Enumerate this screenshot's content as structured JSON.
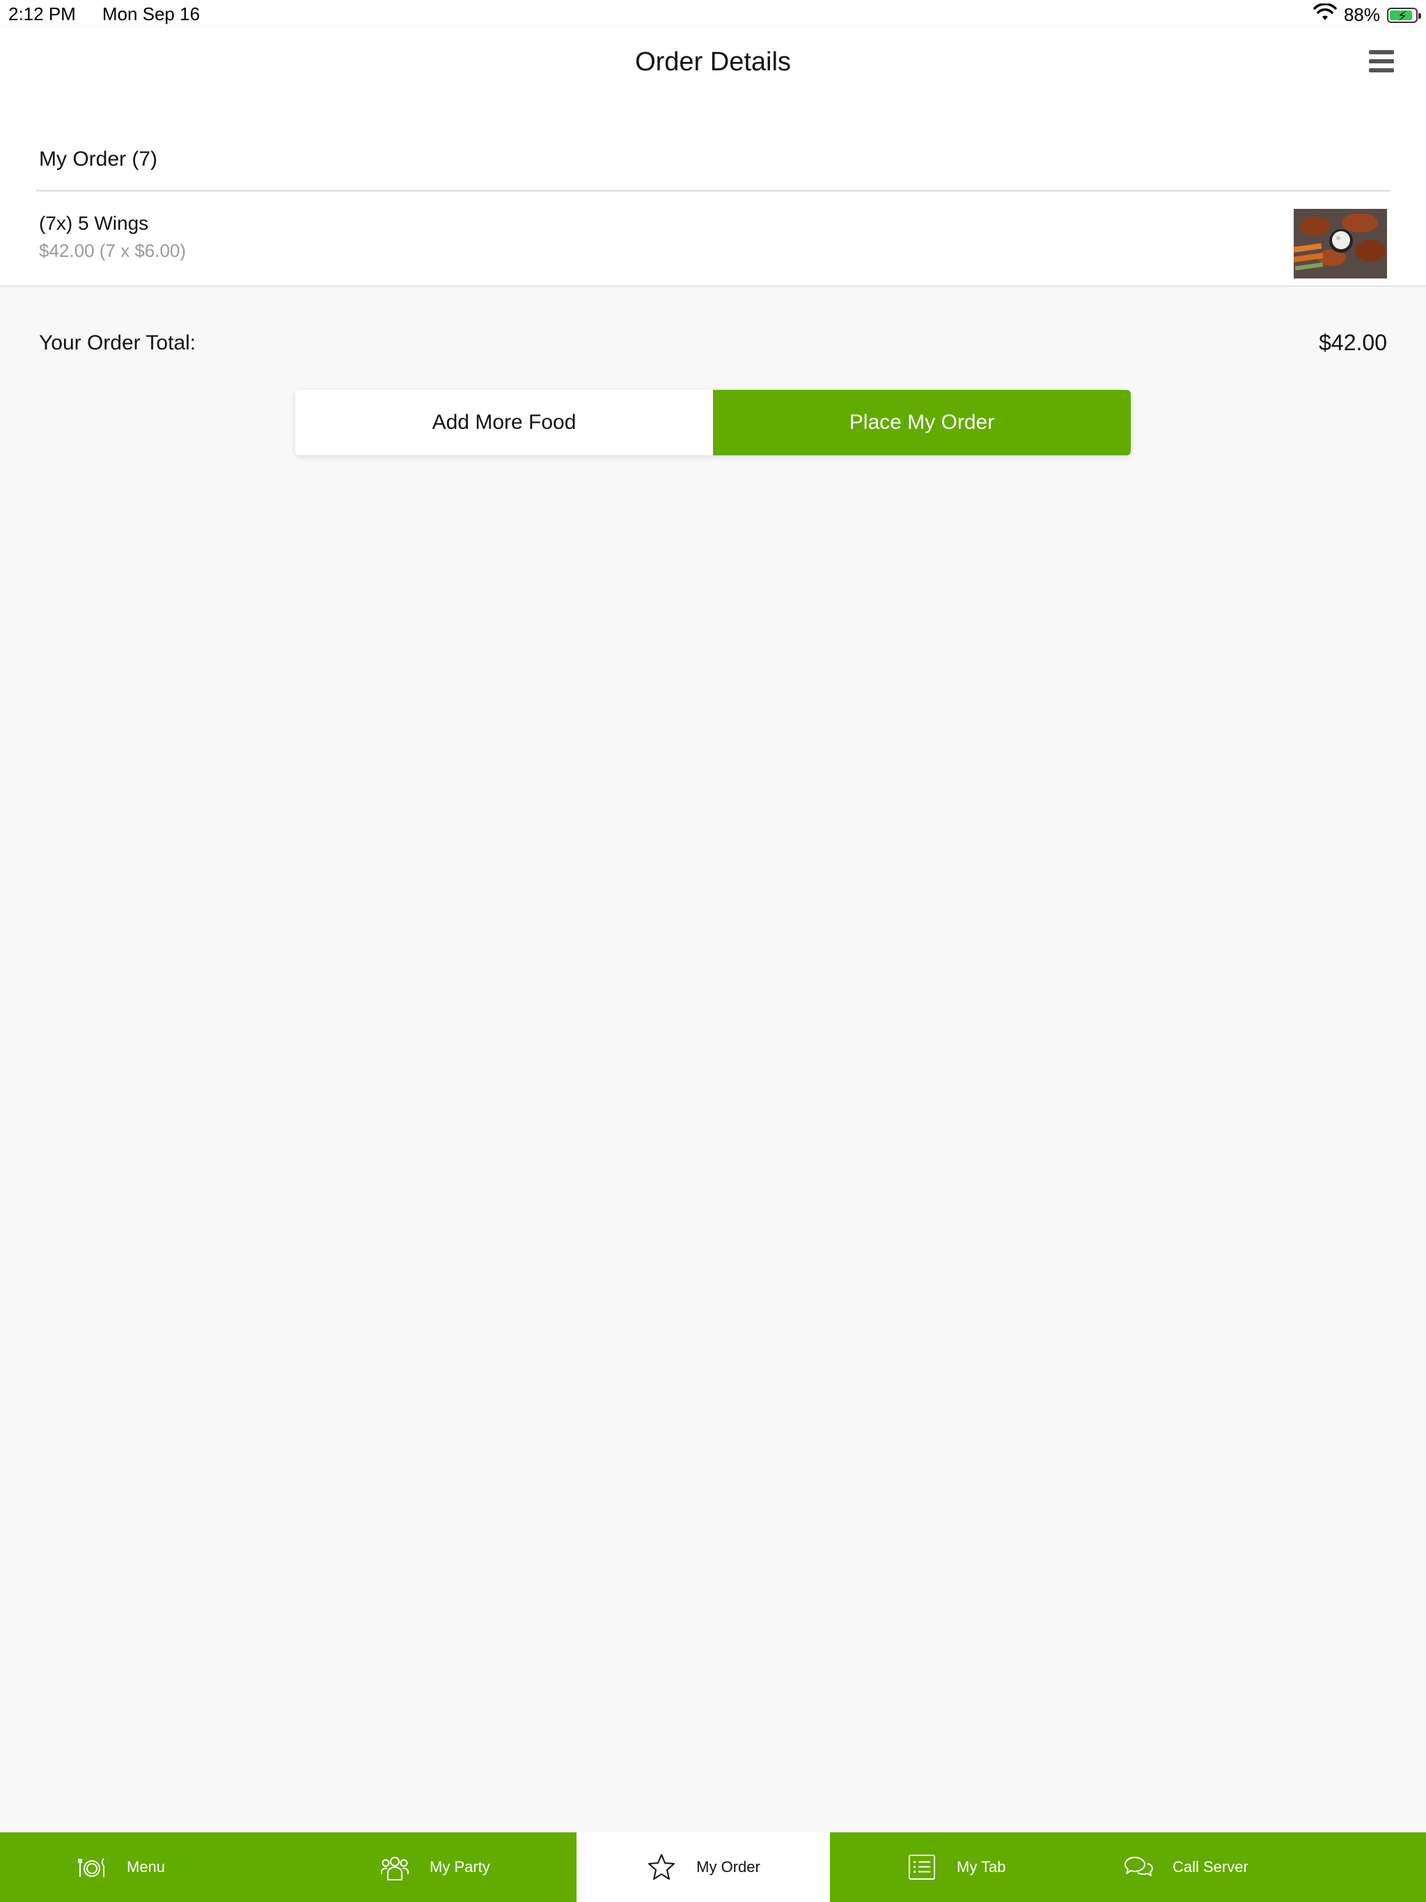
{
  "status_bar": {
    "time": "2:12 PM",
    "date": "Mon Sep 16",
    "battery_percent": "88%",
    "battery_level": 0.88,
    "icons": [
      "wifi-icon",
      "battery-icon"
    ]
  },
  "header": {
    "title": "Order Details",
    "menu_icon": "hamburger-icon"
  },
  "order": {
    "heading": "My Order (7)",
    "items": [
      {
        "name": "(7x) 5 Wings",
        "price": "$42.00 (7 x $6.00)",
        "image_icon": "wings-photo"
      }
    ]
  },
  "total": {
    "label": "Your Order Total:",
    "value": "$42.00"
  },
  "actions": {
    "add_more": "Add More Food",
    "place_order": "Place My Order"
  },
  "bottom_nav": {
    "items": [
      {
        "label": "Menu",
        "icon": "utensils-plate-icon"
      },
      {
        "label": "My Party",
        "icon": "group-icon"
      },
      {
        "label": "My Order",
        "icon": "star-icon",
        "active": true
      },
      {
        "label": "My Tab",
        "icon": "list-icon"
      },
      {
        "label": "Call Server",
        "icon": "chat-bubbles-icon"
      }
    ]
  },
  "colors": {
    "brand_green": "#62ab00",
    "battery_green": "#34c759",
    "background": "#f8f8f8"
  }
}
